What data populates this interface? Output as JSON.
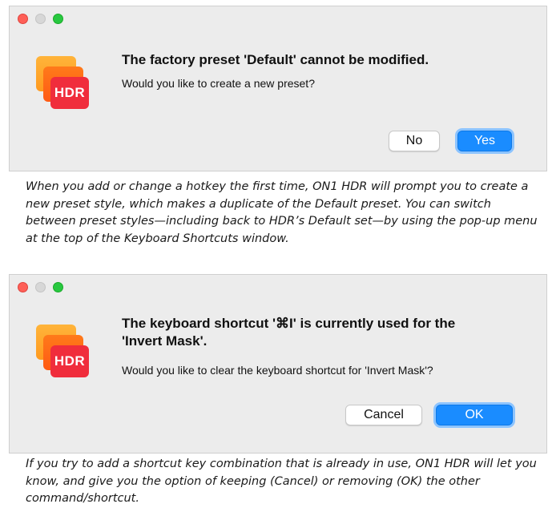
{
  "dialog1": {
    "app_icon_text": "HDR",
    "title": "The factory preset 'Default' cannot be modified.",
    "body": "Would you like to create a new preset?",
    "button_no": "No",
    "button_yes": "Yes"
  },
  "caption1": "When you add or change a hotkey the first time, ON1 HDR will prompt you to create a new preset style, which makes a duplicate of the Default preset. You can switch between preset styles—including back to HDR’s Default set—by using the pop-up menu at the top of the Keyboard Shortcuts window.",
  "dialog2": {
    "app_icon_text": "HDR",
    "title": "The keyboard shortcut '⌘I' is currently used for the 'Invert Mask'.",
    "body": "Would you like to clear the keyboard shortcut for 'Invert Mask'?",
    "button_cancel": "Cancel",
    "button_ok": "OK"
  },
  "caption2": "If you try to add a shortcut key combination that is already in use, ON1 HDR will let you know, and give you the option of keeping (Cancel) or removing (OK) the other command/shortcut.",
  "colors": {
    "accent": "#1a8cff",
    "hdr_red": "#f02d3c",
    "traffic_red": "#fe5f57",
    "traffic_green": "#28c840"
  }
}
